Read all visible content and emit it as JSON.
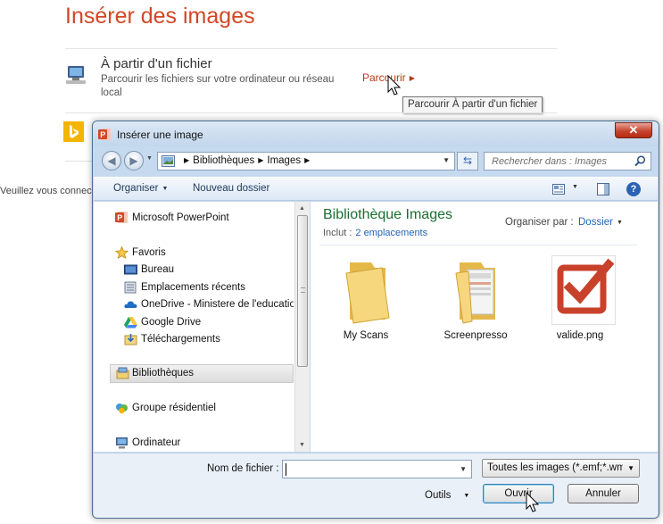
{
  "pane": {
    "title": "Insérer des images",
    "from_file_title": "À partir d'un fichier",
    "from_file_desc": "Parcourir les fichiers sur votre ordinateur ou réseau local",
    "browse_label": "Parcourir",
    "browse_tooltip": "Parcourir À partir d'un fichier",
    "connect_text": "Veuillez vous connecter"
  },
  "dialog": {
    "title": "Insérer une image",
    "close_symbol": "✕",
    "address": {
      "crumbs": [
        "Bibliothèques",
        "Images"
      ]
    },
    "search_placeholder": "Rechercher dans : Images",
    "toolbar": {
      "organize_label": "Organiser",
      "new_folder_label": "Nouveau dossier",
      "help_symbol": "?"
    },
    "nav": {
      "items": [
        {
          "label": "Microsoft PowerPoint",
          "icon": "powerpoint-icon"
        },
        {
          "label": "Favoris",
          "icon": "star-icon"
        },
        {
          "label": "Bureau",
          "icon": "desktop-icon"
        },
        {
          "label": "Emplacements récents",
          "icon": "recent-places-icon"
        },
        {
          "label": "OneDrive - Ministere de l'education",
          "icon": "onedrive-icon"
        },
        {
          "label": "Google Drive",
          "icon": "google-drive-icon"
        },
        {
          "label": "Téléchargements",
          "icon": "downloads-icon"
        },
        {
          "label": "Bibliothèques",
          "icon": "libraries-icon"
        },
        {
          "label": "Groupe résidentiel",
          "icon": "homegroup-icon"
        },
        {
          "label": "Ordinateur",
          "icon": "computer-icon"
        }
      ]
    },
    "content": {
      "library_title": "Bibliothèque Images",
      "includes_label": "Inclut :",
      "includes_link": "2 emplacements",
      "arrange_label": "Organiser par :",
      "arrange_value": "Dossier",
      "files": [
        {
          "name": "My Scans",
          "icon": "folder-icon"
        },
        {
          "name": "Screenpresso",
          "icon": "folder-with-documents-icon"
        },
        {
          "name": "valide.png",
          "icon": "checkbox-image-icon"
        }
      ]
    },
    "bottom": {
      "filename_label": "Nom de fichier :",
      "filename_value": "",
      "filetype_value": "Toutes les images (*.emf;*.wmf",
      "tools_label": "Outils",
      "open_label": "Ouvrir",
      "cancel_label": "Annuler"
    }
  },
  "colors": {
    "accent": "#d24726",
    "library_title": "#1a6e2e",
    "link": "#2364b8"
  }
}
